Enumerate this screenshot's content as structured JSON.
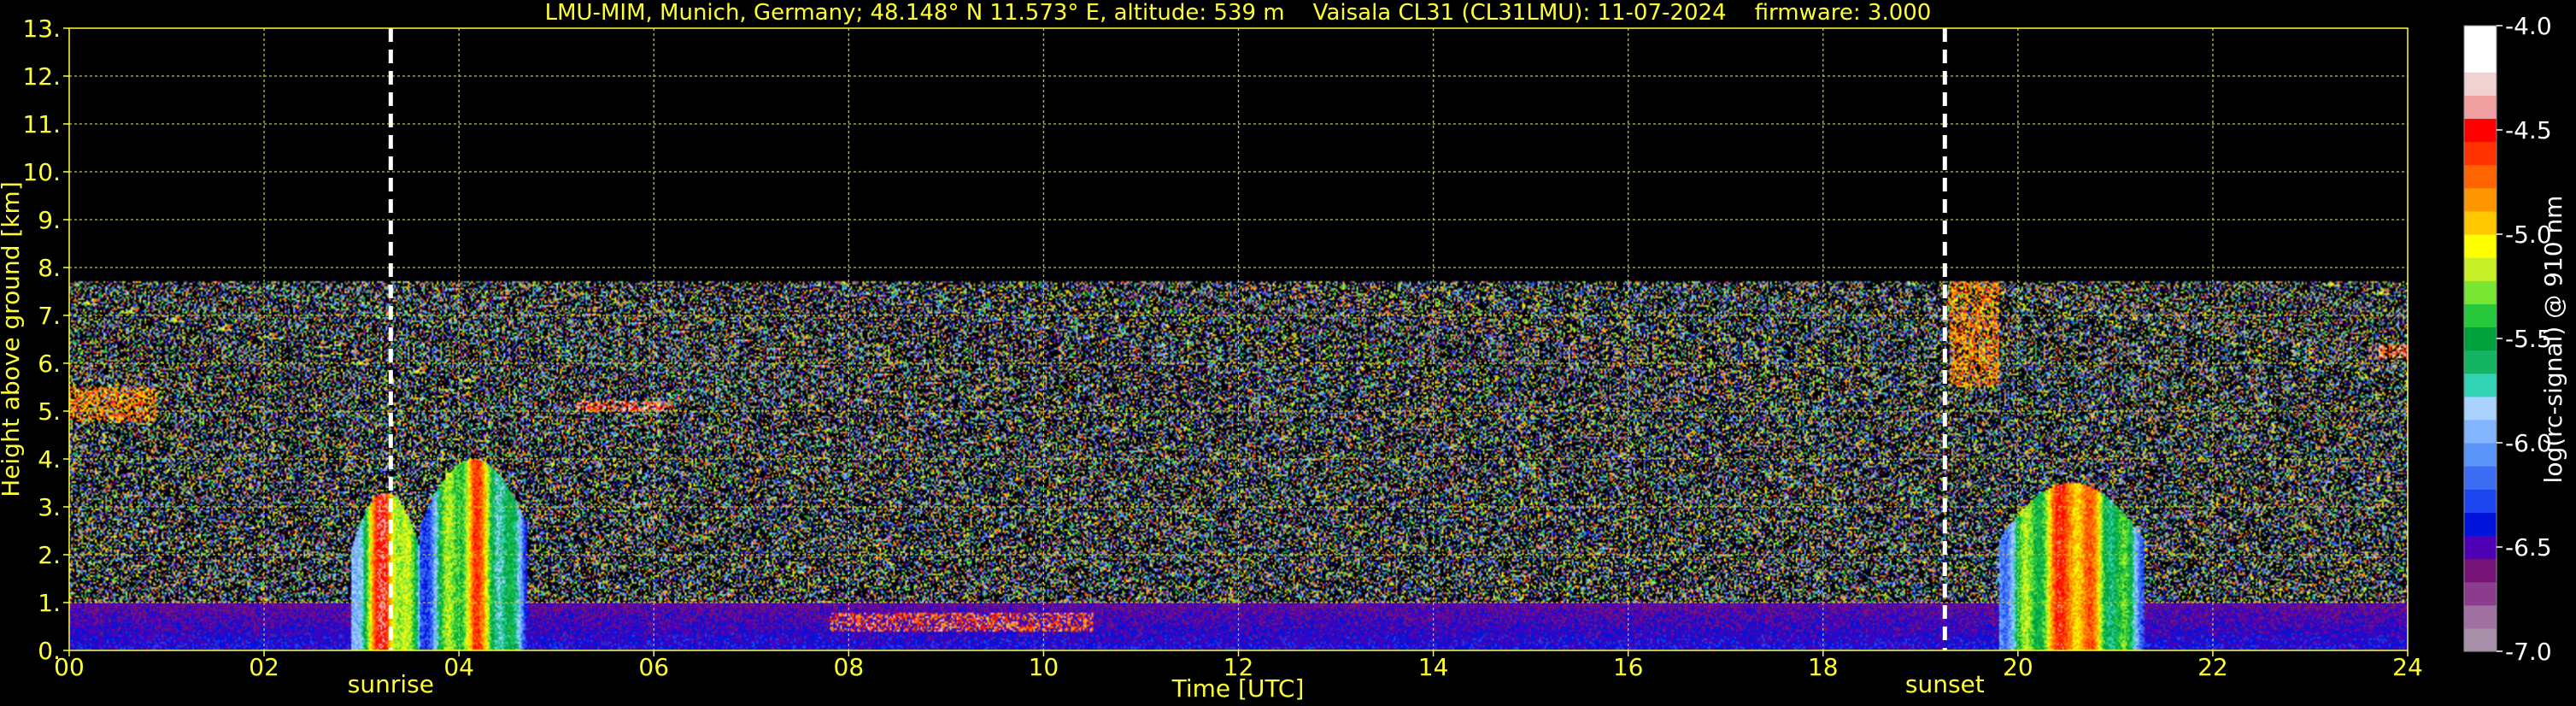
{
  "chart_data": {
    "type": "heatmap",
    "title": "LMU-MIM, Munich, Germany; 48.148° N 11.573° E, altitude: 539 m    Vaisala CL31 (CL31LMU): 11-07-2024    firmware: 3.000",
    "xlabel": "Time [UTC]",
    "ylabel": "Height above ground [km]",
    "xlim": [
      0,
      24
    ],
    "ylim": [
      0,
      13
    ],
    "x_ticks": [
      0,
      2,
      4,
      6,
      8,
      10,
      12,
      14,
      16,
      18,
      20,
      22,
      24
    ],
    "x_tick_labels": [
      "00",
      "02",
      "04",
      "06",
      "08",
      "10",
      "12",
      "14",
      "16",
      "18",
      "20",
      "22",
      "24"
    ],
    "y_ticks": [
      0,
      1,
      2,
      3,
      4,
      5,
      6,
      7,
      8,
      9,
      10,
      11,
      12,
      13
    ],
    "y_tick_labels": [
      "0.",
      "1.",
      "2.",
      "3.",
      "4.",
      "5.",
      "6.",
      "7.",
      "8.",
      "9.",
      "10.",
      "11.",
      "12.",
      "13."
    ],
    "grid": true,
    "grid_color": "#c8c800",
    "max_signal_height_km": 7.7,
    "annotations": [
      {
        "label": "sunrise",
        "x": 3.3
      },
      {
        "label": "sunset",
        "x": 19.25
      }
    ],
    "colorbar": {
      "label": "log(rc-signal) @ 910 nm",
      "range": [
        -7.0,
        -4.0
      ],
      "ticks": [
        -7.0,
        -6.5,
        -6.0,
        -5.5,
        -5.0,
        -4.5,
        -4.0
      ],
      "tick_labels": [
        "-7.0",
        "-6.5",
        "-6.0",
        "-5.5",
        "-5.0",
        "-4.5",
        "-4.0"
      ],
      "colors": [
        "#a890a8",
        "#a070a0",
        "#8c3c8c",
        "#781478",
        "#5000b4",
        "#0014dc",
        "#1e46f0",
        "#3c6ef5",
        "#5a96fa",
        "#82b4ff",
        "#aad2ff",
        "#32d2b4",
        "#14b464",
        "#00a03c",
        "#28c83c",
        "#78e632",
        "#c8f028",
        "#ffff00",
        "#ffc800",
        "#ff9600",
        "#ff6400",
        "#ff3200",
        "#ff0000",
        "#f0a0a0",
        "#f0d2d2",
        "#ffffff",
        "#ffffff"
      ]
    },
    "features": [
      {
        "kind": "aerosol-layer",
        "x_range": [
          0,
          24
        ],
        "height_km": [
          0,
          1.0
        ],
        "level": -6.4
      },
      {
        "kind": "convective-cloud",
        "x_range": [
          2.9,
          3.6
        ],
        "height_km": [
          0,
          3.3
        ],
        "level": -4.2
      },
      {
        "kind": "convective-cloud",
        "x_range": [
          3.6,
          4.7
        ],
        "height_km": [
          0,
          4.0
        ],
        "level": -4.5
      },
      {
        "kind": "convective-cloud",
        "x_range": [
          19.8,
          21.3
        ],
        "height_km": [
          0,
          3.5
        ],
        "level": -4.3
      },
      {
        "kind": "cloud-layer",
        "x_range": [
          5.2,
          6.2
        ],
        "height_km": [
          5.0,
          5.2
        ],
        "level": -4.5
      },
      {
        "kind": "cloud-layer",
        "x_range": [
          0,
          0.9
        ],
        "height_km": [
          4.8,
          5.5
        ],
        "level": -4.8
      },
      {
        "kind": "cloud-layer",
        "x_range": [
          7.8,
          10.5
        ],
        "height_km": [
          0.4,
          0.8
        ],
        "level": -4.6
      },
      {
        "kind": "cloud-layer",
        "x_range": [
          23.7,
          24
        ],
        "height_km": [
          6.1,
          6.4
        ],
        "level": -4.5
      },
      {
        "kind": "cloud-layer",
        "x_range": [
          19.3,
          19.8
        ],
        "height_km": [
          5.5,
          7.7
        ],
        "level": -4.8
      }
    ]
  }
}
